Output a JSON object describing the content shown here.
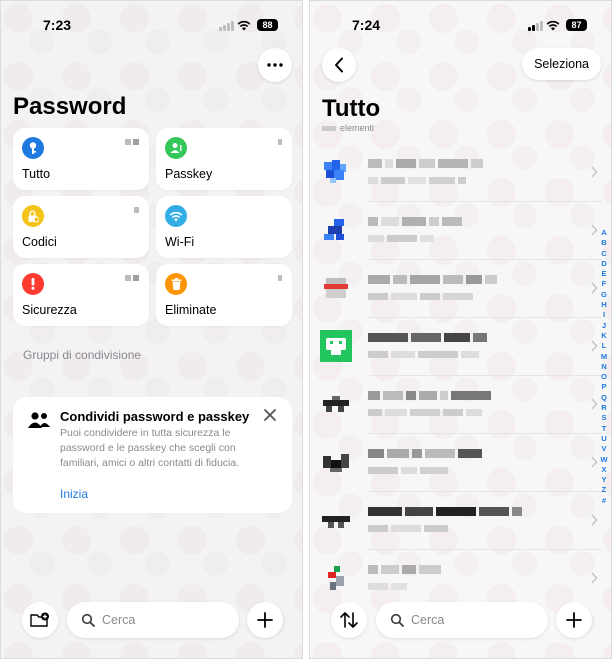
{
  "left": {
    "status": {
      "time": "7:23",
      "battery": "88"
    },
    "title": "Password",
    "tiles": [
      {
        "label": "Tutto",
        "icon": "key-icon",
        "color": "#1f7ae0"
      },
      {
        "label": "Passkey",
        "icon": "person-key-icon",
        "color": "#34c759"
      },
      {
        "label": "Codici",
        "icon": "lock-clock-icon",
        "color": "#f2c318"
      },
      {
        "label": "Wi-Fi",
        "icon": "wifi-icon",
        "color": "#32ade6"
      },
      {
        "label": "Sicurezza",
        "icon": "exclamation-icon",
        "color": "#ff3b30"
      },
      {
        "label": "Eliminate",
        "icon": "trash-icon",
        "color": "#ff9500"
      }
    ],
    "section_title": "Gruppi di condivisione",
    "share_card": {
      "title": "Condividi password e passkey",
      "body": "Puoi condividere in tutta sicurezza le password e le passkey che scegli con familiari, amici o altri contatti di fiducia.",
      "link": "Inizia"
    },
    "search_placeholder": "Cerca"
  },
  "right": {
    "status": {
      "time": "7:24",
      "battery": "87"
    },
    "select_label": "Seleziona",
    "title": "Tutto",
    "count_suffix": "elementi",
    "search_placeholder": "Cerca",
    "alphabet": [
      "A",
      "B",
      "C",
      "D",
      "E",
      "F",
      "G",
      "H",
      "I",
      "J",
      "K",
      "L",
      "M",
      "N",
      "O",
      "P",
      "Q",
      "R",
      "S",
      "T",
      "U",
      "V",
      "W",
      "X",
      "Y",
      "Z",
      "#"
    ],
    "accent": "#1f7ae0"
  }
}
